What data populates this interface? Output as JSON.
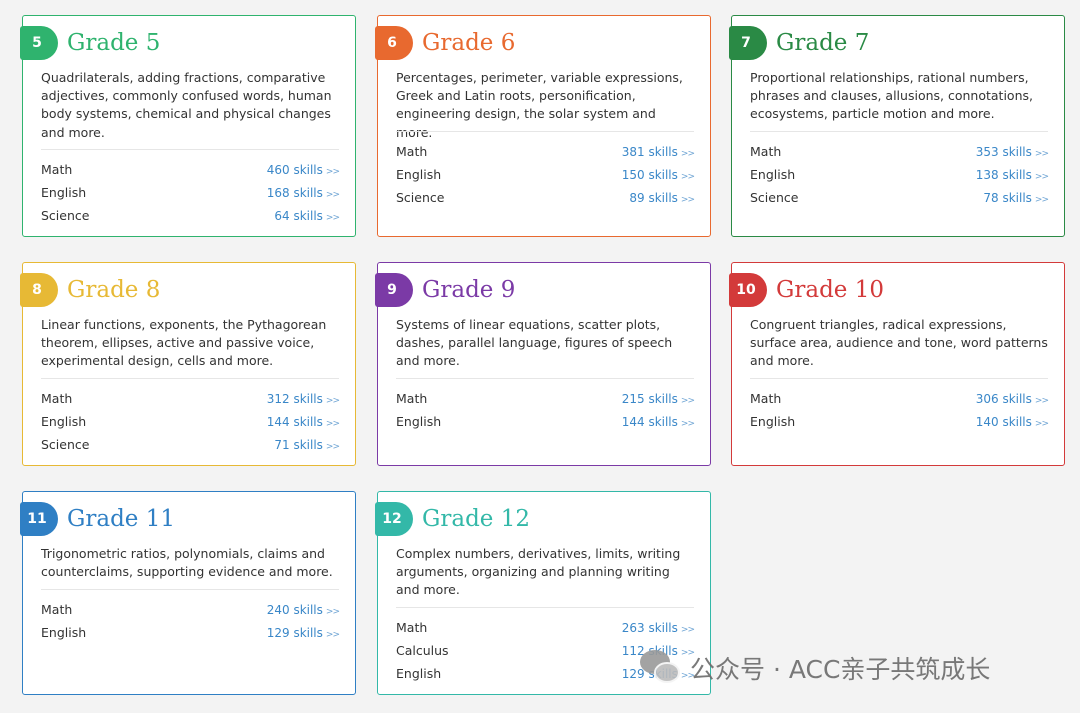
{
  "cards": [
    {
      "grade_number": "5",
      "title": "Grade 5",
      "color": "#2fb36e",
      "description": "Quadrilaterals, adding fractions, comparative adjectives, commonly confused words, human body systems, chemical and physical changes and more.",
      "subjects": [
        {
          "name": "Math",
          "skills": "460 skills"
        },
        {
          "name": "English",
          "skills": "168 skills"
        },
        {
          "name": "Science",
          "skills": "64 skills"
        }
      ]
    },
    {
      "grade_number": "6",
      "title": "Grade 6",
      "color": "#e8692f",
      "description": "Percentages, perimeter, variable expressions, Greek and Latin roots, personification, engineering design, the solar system and more.",
      "subjects": [
        {
          "name": "Math",
          "skills": "381 skills"
        },
        {
          "name": "English",
          "skills": "150 skills"
        },
        {
          "name": "Science",
          "skills": "89 skills"
        }
      ]
    },
    {
      "grade_number": "7",
      "title": "Grade 7",
      "color": "#2a8a45",
      "description": "Proportional relationships, rational numbers, phrases and clauses, allusions, connotations, ecosystems, particle motion and more.",
      "subjects": [
        {
          "name": "Math",
          "skills": "353 skills"
        },
        {
          "name": "English",
          "skills": "138 skills"
        },
        {
          "name": "Science",
          "skills": "78 skills"
        }
      ]
    },
    {
      "grade_number": "8",
      "title": "Grade 8",
      "color": "#e7b935",
      "description": "Linear functions, exponents, the Pythagorean theorem, ellipses, active and passive voice, experimental design, cells and more.",
      "subjects": [
        {
          "name": "Math",
          "skills": "312 skills"
        },
        {
          "name": "English",
          "skills": "144 skills"
        },
        {
          "name": "Science",
          "skills": "71 skills"
        }
      ]
    },
    {
      "grade_number": "9",
      "title": "Grade 9",
      "color": "#7b3aa6",
      "description": "Systems of linear equations, scatter plots, dashes, parallel language, figures of speech and more.",
      "subjects": [
        {
          "name": "Math",
          "skills": "215 skills"
        },
        {
          "name": "English",
          "skills": "144 skills"
        }
      ]
    },
    {
      "grade_number": "10",
      "title": "Grade 10",
      "color": "#d33a3a",
      "description": "Congruent triangles, radical expressions, surface area, audience and tone, word patterns and more.",
      "subjects": [
        {
          "name": "Math",
          "skills": "306 skills"
        },
        {
          "name": "English",
          "skills": "140 skills"
        }
      ]
    },
    {
      "grade_number": "11",
      "title": "Grade 11",
      "color": "#2f7fc4",
      "description": "Trigonometric ratios, polynomials, claims and counterclaims, supporting evidence and more.",
      "subjects": [
        {
          "name": "Math",
          "skills": "240 skills"
        },
        {
          "name": "English",
          "skills": "129 skills"
        }
      ]
    },
    {
      "grade_number": "12",
      "title": "Grade 12",
      "color": "#33b8a8",
      "description": "Complex numbers, derivatives, limits, writing arguments, organizing and planning writing and more.",
      "subjects": [
        {
          "name": "Math",
          "skills": "263 skills"
        },
        {
          "name": "Calculus",
          "skills": "112 skills"
        },
        {
          "name": "English",
          "skills": "129 skills"
        }
      ]
    }
  ],
  "arrow_glyph": ">>",
  "watermark": {
    "icon": "wechat-icon",
    "text": "公众号 · ACC亲子共筑成长"
  }
}
